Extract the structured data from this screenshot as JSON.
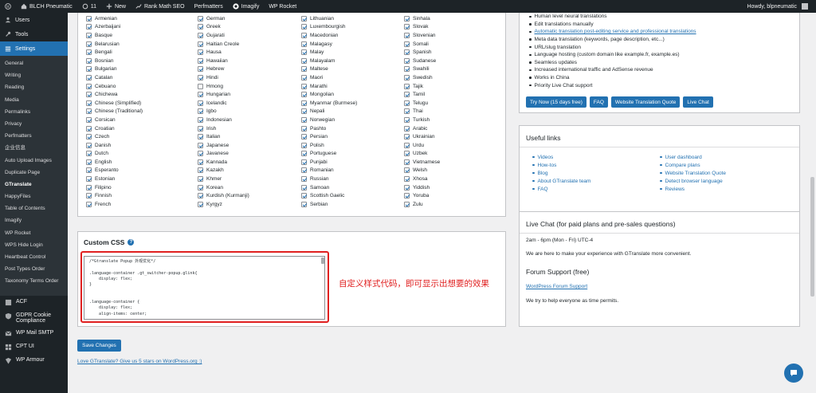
{
  "adminbar": {
    "site": "BLCH Pneumatic",
    "updates": "11",
    "new": "New",
    "rankmath": "Rank Math SEO",
    "perfmatters": "Perfmatters",
    "imagify": "Imagify",
    "wprocket": "WP Rocket",
    "howdy": "Howdy, blpneumatic"
  },
  "sidebar": {
    "top": [
      {
        "label": "Users",
        "icon": "users-icon"
      },
      {
        "label": "Tools",
        "icon": "tools-icon"
      }
    ],
    "settings": "Settings",
    "sub": [
      "General",
      "Writing",
      "Reading",
      "Media",
      "Permalinks",
      "Privacy",
      "Perfmatters",
      "企业信息",
      "Auto Upload Images",
      "Duplicate Page",
      "GTranslate",
      "HappyFiles",
      "Table of Contents",
      "Imagify",
      "WP Rocket",
      "WPS Hide Login",
      "Heartbeat Control"
    ],
    "post_types": "Post Types Order",
    "taxonomy": "Taxonomy Terms Order",
    "bottom": [
      {
        "label": "ACF",
        "icon": "acf-icon"
      },
      {
        "label": "GDPR Cookie Compliance",
        "icon": "shield-icon"
      },
      {
        "label": "WP Mail SMTP",
        "icon": "mail-icon"
      },
      {
        "label": "CPT UI",
        "icon": "cpt-icon"
      },
      {
        "label": "WP Armour",
        "icon": "armour-icon"
      }
    ]
  },
  "languages": [
    [
      "Armenian",
      "Azerbaijani",
      "Basque",
      "Belarusian",
      "Bengali",
      "Bosnian",
      "Bulgarian",
      "Catalan",
      "Cebuano",
      "Chichewa",
      "Chinese (Simplified)",
      "Chinese (Traditional)",
      "Corsican",
      "Croatian",
      "Czech",
      "Danish",
      "Dutch",
      "English",
      "Esperanto",
      "Estonian",
      "Filipino",
      "Finnish",
      "French"
    ],
    [
      "German",
      "Greek",
      "Gujarati",
      "Haitian Creole",
      "Hausa",
      "Hawaiian",
      "Hebrew",
      "Hindi",
      "Hmong",
      "Hungarian",
      "Icelandic",
      "Igbo",
      "Indonesian",
      "Irish",
      "Italian",
      "Japanese",
      "Javanese",
      "Kannada",
      "Kazakh",
      "Khmer",
      "Korean",
      "Kurdish (Kurmanji)",
      "Kyrgyz"
    ],
    [
      "Lithuanian",
      "Luxembourgish",
      "Macedonian",
      "Malagasy",
      "Malay",
      "Malayalam",
      "Maltese",
      "Maori",
      "Marathi",
      "Mongolian",
      "Myanmar (Burmese)",
      "Nepali",
      "Norwegian",
      "Pashto",
      "Persian",
      "Polish",
      "Portuguese",
      "Punjabi",
      "Romanian",
      "Russian",
      "Samoan",
      "Scottish Gaelic",
      "Serbian"
    ],
    [
      "Sinhala",
      "Slovak",
      "Slovenian",
      "Somali",
      "Spanish",
      "Sudanese",
      "Swahili",
      "Swedish",
      "Tajik",
      "Tamil",
      "Telugu",
      "Thai",
      "Turkish",
      "Arabic",
      "Ukrainian",
      "Urdu",
      "Uzbek",
      "Vietnamese",
      "Welsh",
      "Xhosa",
      "Yiddish",
      "Yoruba",
      "Zulu"
    ]
  ],
  "unchecked": [
    "Hmong"
  ],
  "css": {
    "title": "Custom CSS",
    "help": "?",
    "code": "/*Gtranslate Popup 外观优化*/\n\n.language-container .gt_switcher-popup.glink{\n    display: flex;\n}\n\n\n.language-container {\n    display: flex;\n    align-items: center;\n    ...",
    "annotation": "自定义样式代码，即可显示出想要的效果"
  },
  "save": "Save Changes",
  "love": "Love GTranslate? Give us 5 stars on WordPress.org :)",
  "features": [
    "Human level neural translations",
    "Edit translations manually",
    "Automatic translation post-editing service and professional translations",
    "Meta data translation (keywords, page description, etc...)",
    "URL/slug translation",
    "Language hosting (custom domain like example.fr, example.es)",
    "Seamless updates",
    "Increased international traffic and AdSense revenue",
    "Works in China",
    "Priority Live Chat support"
  ],
  "feature_link_index": 2,
  "pro_buttons": [
    "Try Now (15 days free)",
    "FAQ",
    "Website Translation Quote",
    "Live Chat"
  ],
  "useful": {
    "title": "Useful links",
    "left": [
      "Videos",
      "How-tos",
      "Blog",
      "About GTranslate team",
      "FAQ"
    ],
    "right": [
      "User dashboard",
      "Compare plans",
      "Website Translation Quote",
      "Detect browser language",
      "Reviews"
    ]
  },
  "chat": {
    "title": "Live Chat (for paid plans and pre-sales questions)",
    "hours": "2am - 6pm (Mon - Fri) UTC-4",
    "desc": "We are here to make your experience with GTranslate more convenient.",
    "forum_title": "Forum Support (free)",
    "forum_link": "WordPress Forum Support",
    "forum_desc": "We try to help everyone as time permits."
  }
}
